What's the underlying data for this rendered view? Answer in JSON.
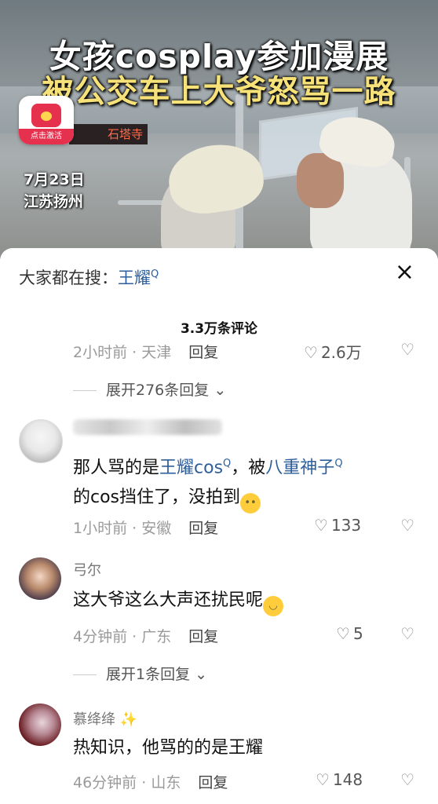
{
  "video": {
    "headline_line1": "女孩cosplay参加漫展",
    "headline_line2": "被公交车上大爷怒骂一路",
    "badge_label": "点击激活",
    "bus_sign": "石塔寺",
    "date": "7月23日",
    "location": "江苏扬州"
  },
  "search": {
    "prefix": "大家都在搜：",
    "keyword": "王耀",
    "search_glyph": "Q"
  },
  "close_icon": "×",
  "comment_count": "3.3万条评论",
  "prev_comment": {
    "time": "2小时前",
    "region": "天津",
    "reply_label": "回复",
    "likes": "2.6万",
    "expand_label": "展开276条回复"
  },
  "comments": [
    {
      "username": "",
      "text_parts": [
        "那人骂的是",
        "王耀cos",
        "，被",
        "八重神子",
        "的cos挡住了，没拍到"
      ],
      "time": "1小时前",
      "region": "安徽",
      "reply_label": "回复",
      "likes": "133"
    },
    {
      "username": "弓尔",
      "text": "这大爷这么大声还扰民呢",
      "time": "4分钟前",
      "region": "广东",
      "reply_label": "回复",
      "likes": "5",
      "expand_label": "展开1条回复"
    },
    {
      "username": "慕绛绛",
      "text": "热知识，他骂的的是王耀",
      "time": "46分钟前",
      "region": "山东",
      "reply_label": "回复",
      "likes": "148"
    }
  ],
  "colors": {
    "link": "#2e5e9c",
    "headline_yellow": "#f7e27a",
    "badge_red": "#e5304e"
  }
}
